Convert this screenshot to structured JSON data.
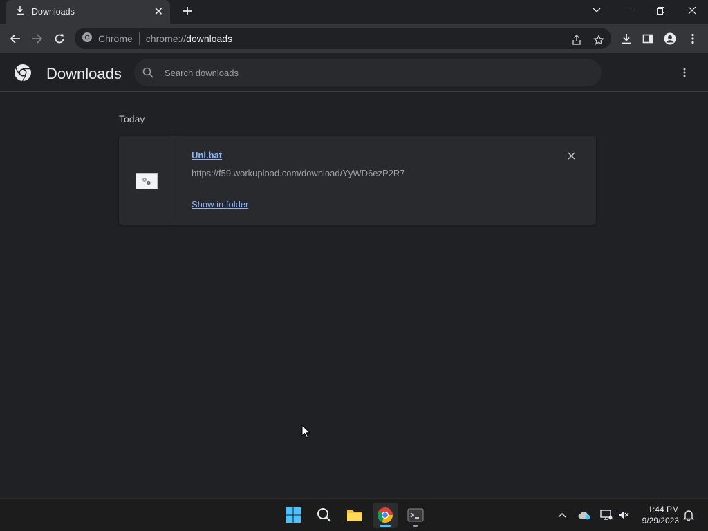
{
  "browser": {
    "tab_title": "Downloads",
    "omnibox_chip": "Chrome",
    "url_scheme": "chrome://",
    "url_host": "downloads"
  },
  "downloads_page": {
    "title": "Downloads",
    "search_placeholder": "Search downloads",
    "section_label": "Today",
    "items": [
      {
        "filename": "Uni.bat",
        "url": "https://f59.workupload.com/download/YyWD6ezP2R7",
        "action_label": "Show in folder"
      }
    ]
  },
  "taskbar": {
    "time": "1:44 PM",
    "date": "9/29/2023"
  },
  "colors": {
    "accent_link": "#8ab4f8",
    "page_bg": "#202124",
    "toolbar_bg": "#35363a"
  }
}
